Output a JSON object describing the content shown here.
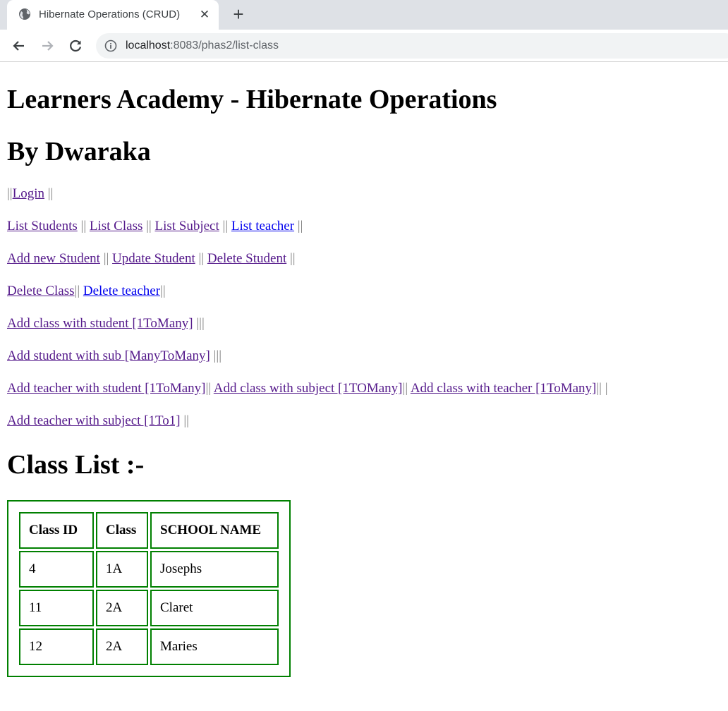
{
  "browser": {
    "tab_title": "Hibernate Operations (CRUD)",
    "url_host": "localhost",
    "url_path": ":8083/phas2/list-class"
  },
  "page": {
    "title": "Learners Academy - Hibernate Operations",
    "author": "By Dwaraka",
    "nav": {
      "row1": {
        "pre": "||",
        "login": "Login",
        "post": " ||"
      },
      "row2": {
        "list_students": "List Students",
        "list_class": "List Class",
        "list_subject": "List Subject",
        "list_teacher": "List teacher",
        "sep": " || ",
        "end": " ||"
      },
      "row3": {
        "add_student": "Add new Student",
        "update_student": "Update Student",
        "delete_student": "Delete Student",
        "sep": " || ",
        "end": " ||"
      },
      "row4": {
        "delete_class": "Delete Class",
        "delete_teacher": "Delete teacher",
        "sep": "|| ",
        "end": "||"
      },
      "row5": {
        "add_class_student": "Add class with student [1ToMany]",
        "end": " |||"
      },
      "row6": {
        "add_student_sub": "Add student with sub [ManyToMany]",
        "end": " |||"
      },
      "row7": {
        "add_teacher_student": "Add teacher with student [1ToMany]",
        "add_class_subject": "Add class with subject [1TOMany]",
        "add_class_teacher": "Add class with teacher [1ToMany]",
        "sep": "|| ",
        "end": "|| |"
      },
      "row8": {
        "add_teacher_subject": "Add teacher with subject [1To1]",
        "end": " ||"
      }
    },
    "list_heading": "Class List :-",
    "table": {
      "headers": [
        "Class ID",
        "Class",
        "SCHOOL NAME"
      ],
      "rows": [
        [
          "4",
          "1A",
          "Josephs"
        ],
        [
          "11",
          "2A",
          "Claret"
        ],
        [
          "12",
          "2A",
          "Maries"
        ]
      ]
    },
    "colors": {
      "table_border": "#008000",
      "visited_link": "#551a8b",
      "link": "#0000ee"
    }
  }
}
